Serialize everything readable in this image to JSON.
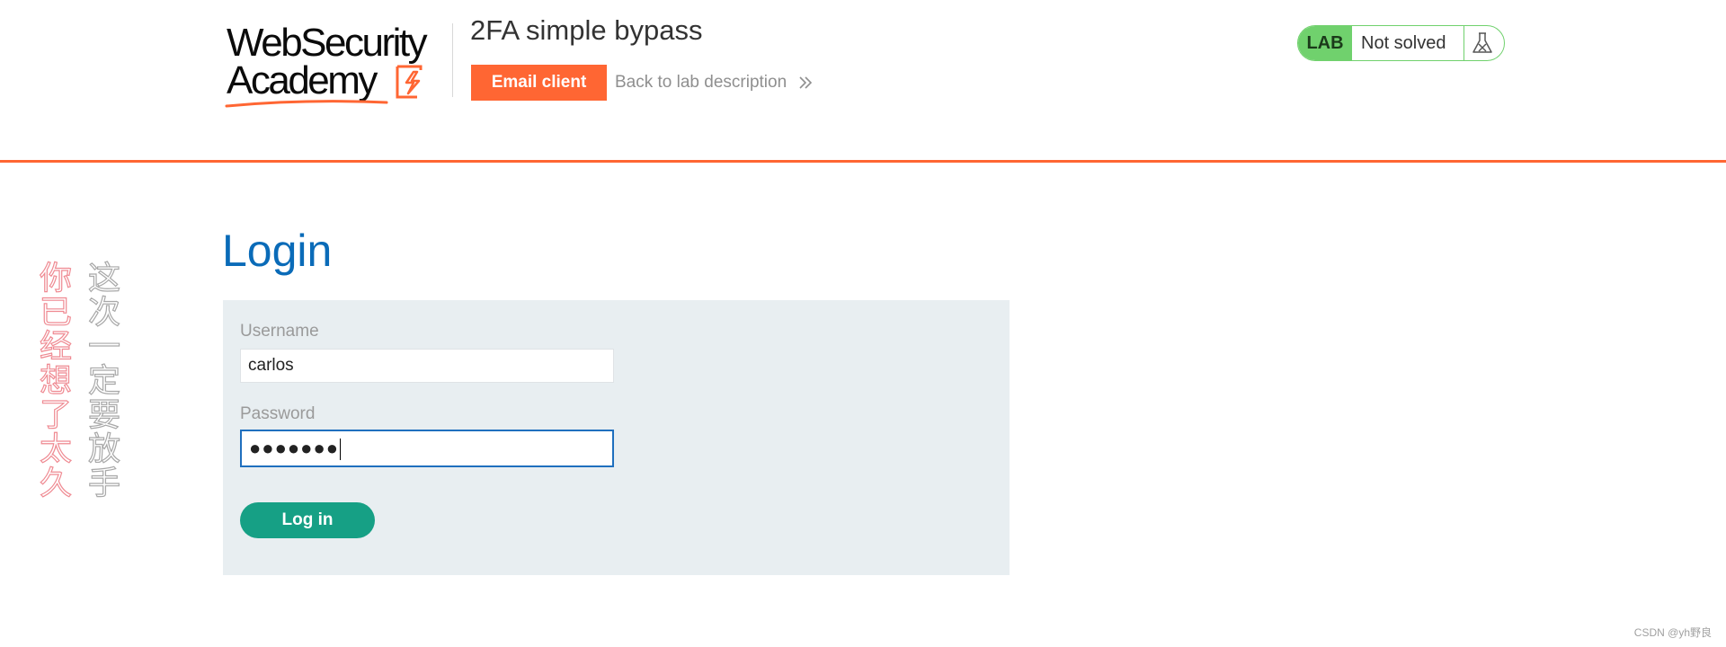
{
  "header": {
    "logo": {
      "line1": "WebSecurity",
      "line2": "Academy"
    },
    "lab_title": "2FA simple bypass",
    "email_client_label": "Email client",
    "back_link_label": "Back to lab description",
    "lab_status": {
      "badge": "LAB",
      "state": "Not solved",
      "icon": "flask-icon"
    },
    "accent_color": "#ff6633"
  },
  "side_text": {
    "red_column": "你已经想了太久",
    "gray_column": "这次一定要放手"
  },
  "main": {
    "heading": "Login",
    "form": {
      "username_label": "Username",
      "username_value": "carlos",
      "password_label": "Password",
      "password_value": "●●●●●●●",
      "submit_label": "Log in"
    }
  },
  "footer": {
    "watermark": "CSDN @yh野良"
  },
  "colors": {
    "heading_blue": "#0a6bb8",
    "button_green": "#16a085",
    "status_green": "#70d16d",
    "panel_bg": "#e8eef1"
  }
}
